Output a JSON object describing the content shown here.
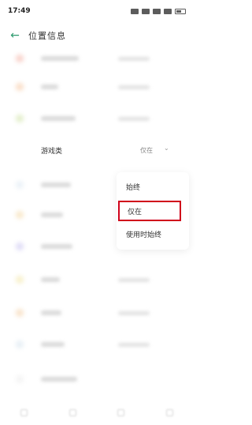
{
  "status": {
    "time": "17:49"
  },
  "header": {
    "title": "位置信息",
    "back_icon": "arrow-left-icon"
  },
  "game_row": {
    "label": "游戏类",
    "value": "仅在"
  },
  "menu": {
    "items": [
      {
        "label": "始终"
      },
      {
        "label": "仅在"
      },
      {
        "label": "使用时始终"
      }
    ],
    "selected_index": 1
  },
  "colors": {
    "accent": "#2e9b6e",
    "highlight": "#d0021b"
  }
}
